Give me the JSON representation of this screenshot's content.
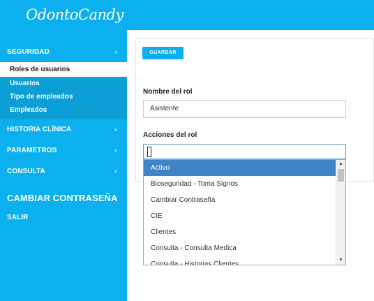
{
  "app": {
    "logo": "OdontoCandy"
  },
  "sidebar": {
    "seguridad": {
      "label": "SEGURIDAD",
      "chevron": "‹"
    },
    "seguridad_items": [
      {
        "label": "Roles de usuarios"
      },
      {
        "label": "Usuarios"
      },
      {
        "label": "Tipo de empleados"
      },
      {
        "label": "Empleados"
      }
    ],
    "historia": {
      "label": "HISTORIA CLÍNICA",
      "chevron": "‹"
    },
    "parametros": {
      "label": "PARAMETROS",
      "chevron": "‹"
    },
    "consulta": {
      "label": "CONSULTA",
      "chevron": "‹"
    },
    "cambiar": {
      "label": "CAMBIAR CONTRASEÑA"
    },
    "salir": {
      "label": "SALIR"
    }
  },
  "form": {
    "save_label": "GUARDAR",
    "nombre_label": "Nombre del rol",
    "nombre_value": "Asistente",
    "acciones_label": "Acciones del rol",
    "acciones_value": ""
  },
  "dropdown": {
    "options": [
      "Activo",
      "Bioseguridad - Toma Signos",
      "Cambiar Contraseña",
      "CIE",
      "Clientes",
      "Consulta - Consulta Medica",
      "Consulta - Historias Clientes"
    ],
    "highlighted": "Activo",
    "scroll_up": "▲",
    "scroll_down": "▼"
  },
  "colors": {
    "primary": "#0cb0ee",
    "submenu": "#0b9fd6",
    "highlight": "#3d85c6"
  }
}
